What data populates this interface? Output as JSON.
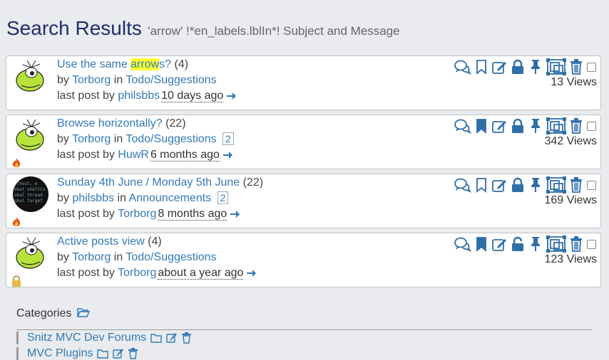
{
  "header": {
    "title": "Search Results",
    "subtitle": "'arrow' !*en_labels.lblIn*! Subject and Message"
  },
  "labels": {
    "by": "by",
    "in": "in",
    "last_post": "last post by"
  },
  "topics": [
    {
      "subject_pre": "Use the same ",
      "subject_hl": "arrow",
      "subject_post": "s?",
      "replies": "(4)",
      "author": "Torborg",
      "forum": "Todo/Suggestions",
      "pages": "",
      "last_author": "philsbbs",
      "ago": "10 days ago",
      "views": "13 Views",
      "bookmarked": false,
      "locked": true,
      "status_icon": "none",
      "avatar": "green-lizard"
    },
    {
      "subject_pre": "Browse horizontally?",
      "subject_hl": "",
      "subject_post": "",
      "replies": "(22)",
      "author": "Torborg",
      "forum": "Todo/Suggestions",
      "pages": "2",
      "last_author": "HuwR",
      "ago": "6 months ago",
      "views": "342 Views",
      "bookmarked": true,
      "locked": true,
      "status_icon": "hot-fire-icon",
      "avatar": "green-lizard"
    },
    {
      "subject_pre": "Sunday 4th June / Monday 5th June",
      "subject_hl": "",
      "subject_post": "",
      "replies": "(22)",
      "author": "philsbbs",
      "forum": "Announcements",
      "pages": "2",
      "last_author": "Torborg",
      "ago": "8 months ago",
      "views": "169 Views",
      "bookmarked": false,
      "locked": true,
      "status_icon": "hot-fire-icon",
      "avatar": "code-screen"
    },
    {
      "subject_pre": "Active posts view",
      "subject_hl": "",
      "subject_post": "",
      "replies": "(4)",
      "author": "Torborg",
      "forum": "Todo/Suggestions",
      "pages": "",
      "last_author": "Torborg",
      "ago": "about a year ago",
      "views": "123 Views",
      "bookmarked": true,
      "locked": false,
      "status_icon": "lock-badge-icon",
      "avatar": "green-lizard"
    }
  ],
  "categories": {
    "title": "Categories",
    "items": [
      "Snitz MVC Dev Forums",
      "MVC Plugins"
    ]
  },
  "colors": {
    "link": "#337ab7",
    "icon": "#2f6fa8",
    "title": "#1e2f6e",
    "highlight": "#ffff33"
  }
}
